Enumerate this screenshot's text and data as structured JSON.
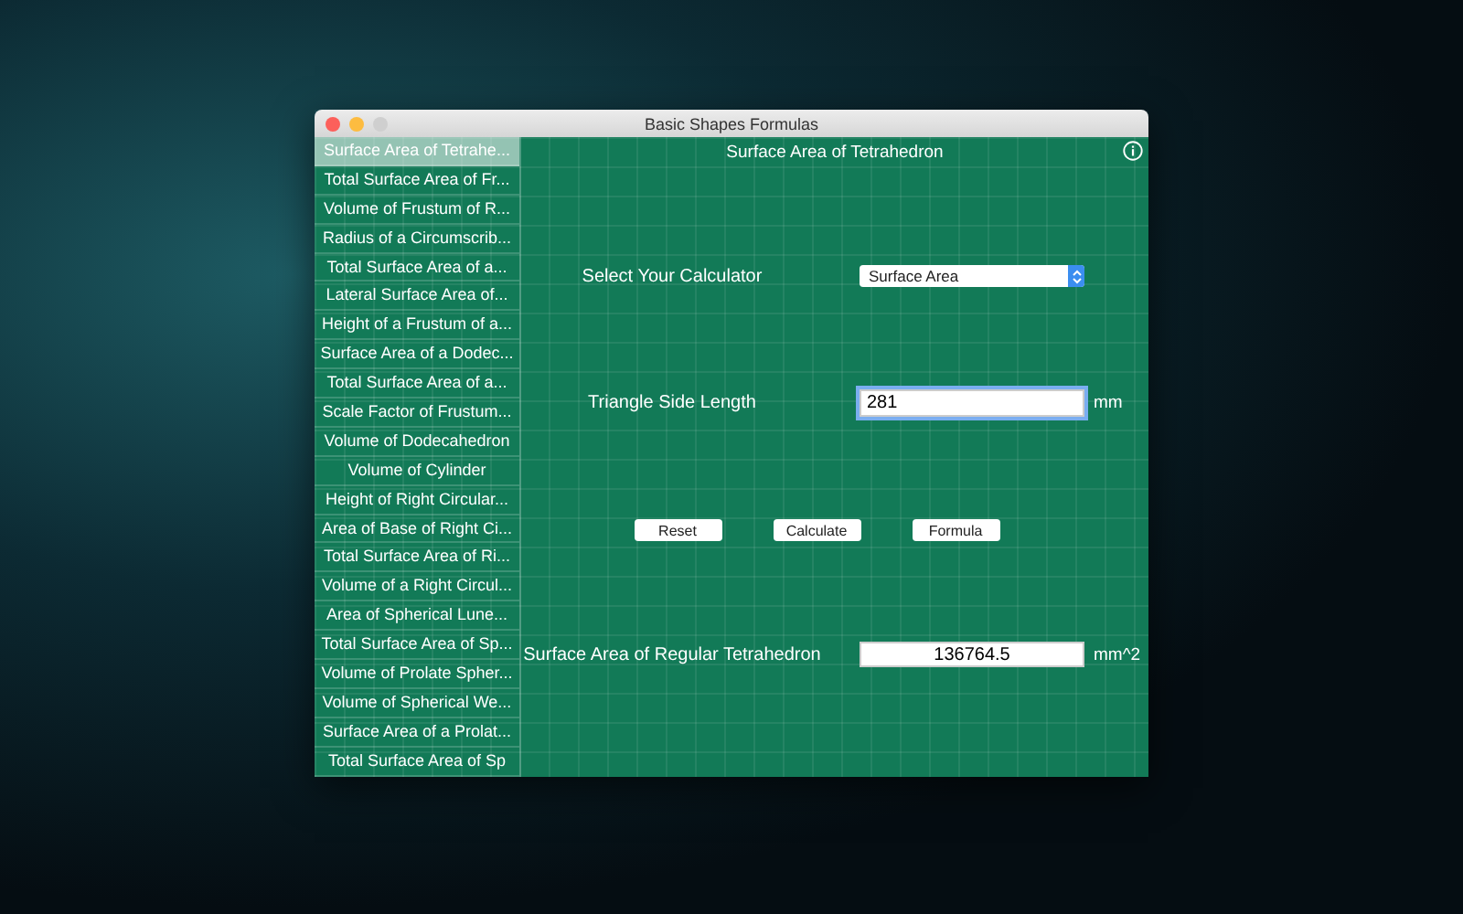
{
  "window": {
    "title": "Basic Shapes Formulas"
  },
  "sidebar": {
    "items": [
      {
        "label": "Surface Area of Tetrahe...",
        "selected": true
      },
      {
        "label": "Total Surface Area of Fr...",
        "selected": false
      },
      {
        "label": "Volume of Frustum of R...",
        "selected": false
      },
      {
        "label": "Radius of a Circumscrib...",
        "selected": false
      },
      {
        "label": "Total Surface Area of a...",
        "selected": false
      },
      {
        "label": "Lateral Surface Area of...",
        "selected": false
      },
      {
        "label": "Height of a Frustum of a...",
        "selected": false
      },
      {
        "label": "Surface Area of a Dodec...",
        "selected": false
      },
      {
        "label": "Total Surface Area of a...",
        "selected": false
      },
      {
        "label": "Scale Factor of Frustum...",
        "selected": false
      },
      {
        "label": "Volume of Dodecahedron",
        "selected": false
      },
      {
        "label": "Volume of Cylinder",
        "selected": false
      },
      {
        "label": "Height of Right Circular...",
        "selected": false
      },
      {
        "label": "Area of Base of Right Ci...",
        "selected": false
      },
      {
        "label": "Total Surface Area of Ri...",
        "selected": false
      },
      {
        "label": "Volume of a Right Circul...",
        "selected": false
      },
      {
        "label": "Area of Spherical Lune...",
        "selected": false
      },
      {
        "label": "Total Surface Area of Sp...",
        "selected": false
      },
      {
        "label": "Volume of Prolate Spher...",
        "selected": false
      },
      {
        "label": "Volume of Spherical We...",
        "selected": false
      },
      {
        "label": "Surface Area of a Prolat...",
        "selected": false
      },
      {
        "label": "Total Surface Area of Sp",
        "selected": false
      }
    ]
  },
  "content": {
    "heading": "Surface Area of Tetrahedron",
    "calculator": {
      "label": "Select Your Calculator",
      "value": "Surface Area"
    },
    "input": {
      "label": "Triangle Side Length",
      "value": "281",
      "unit": "mm"
    },
    "buttons": [
      "Reset",
      "Calculate",
      "Formula"
    ],
    "result": {
      "label": "Surface Area of Regular Tetrahedron",
      "value": "136764.5",
      "unit": "mm^2"
    }
  }
}
